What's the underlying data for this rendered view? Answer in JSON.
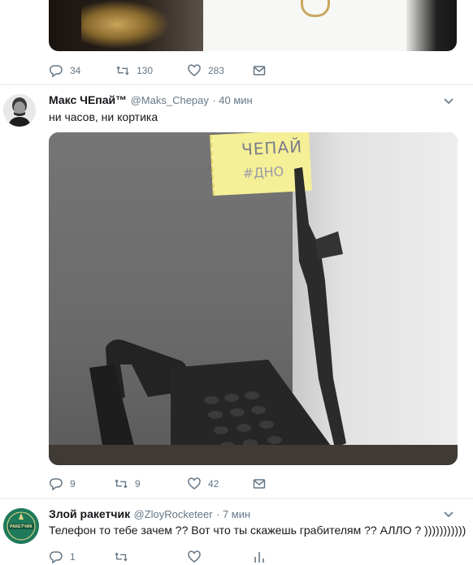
{
  "tweet_prev": {
    "replies": "34",
    "retweets": "130",
    "likes": "283"
  },
  "tweet_main": {
    "name": "Макс ЧЕпай™",
    "handle": "@Maks_Chepay",
    "time": "· 40 мин",
    "text": "ни часов, ни кортика",
    "photo_note_line1": "ЧЕПАЙ",
    "photo_note_line2": "#ДНО",
    "replies": "9",
    "retweets": "9",
    "likes": "42"
  },
  "tweet_reply": {
    "name": "Злой ракетчик",
    "handle": "@ZloyRocketeer",
    "time": "· 7 мин",
    "text": "Телефон то тебе зачем ?? Вот что ты скажешь грабителям ?? АЛЛО ? )))))))))))",
    "avatar_label": "РАКЕТЧИК",
    "replies": "1"
  },
  "colors": {
    "muted": "#657786",
    "text": "#14171a",
    "divider": "#e6ecf0",
    "reply_avatar_bg": "#1e7a5a"
  }
}
